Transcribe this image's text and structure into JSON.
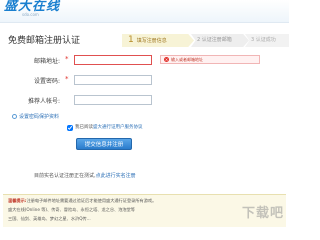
{
  "header": {
    "logo": "盛大在线",
    "logo_sub": "sdo.com"
  },
  "page_title": "免费邮箱注册认证",
  "steps": {
    "step1_num": "1",
    "step1_label": "填写注册信息",
    "step2_label": "2 认证注册邮箱",
    "step3_label": "3 认证成功"
  },
  "form": {
    "email_label": "邮箱地址:",
    "password_label": "设置密码:",
    "referrer_label": "推荐人帐号:",
    "required_mark": "*",
    "error_icon": "×",
    "email_error": "输入或者邮箱地址",
    "security_link": "设置密码保护资料",
    "agree_prefix": "我已阅读",
    "agree_link": "盛大通行证用户服务协议",
    "submit_label": "提交信息并注册"
  },
  "verify": {
    "text": "目前实名认证注册正在测试,",
    "link": "点此进行实名注册"
  },
  "notice": {
    "head": "温馨提示:",
    "line1": "注册电子邮件地址需要通过验证后才能使用盛大通行证登录所有游戏。",
    "line2": "盛大在线(Online 等)、传奇、冒险岛、永恒之塔、龙之谷、泡泡堂等",
    "line3": "三国、仙剑、英雄岛、梦幻之星、水浒Q传..."
  },
  "watermark": "下载吧",
  "colors": {
    "accent": "#2a7ccc",
    "error": "#e0302a",
    "step_active": "#f7f3d6"
  },
  "icons": {
    "error": "error-icon",
    "security": "shield-icon"
  }
}
